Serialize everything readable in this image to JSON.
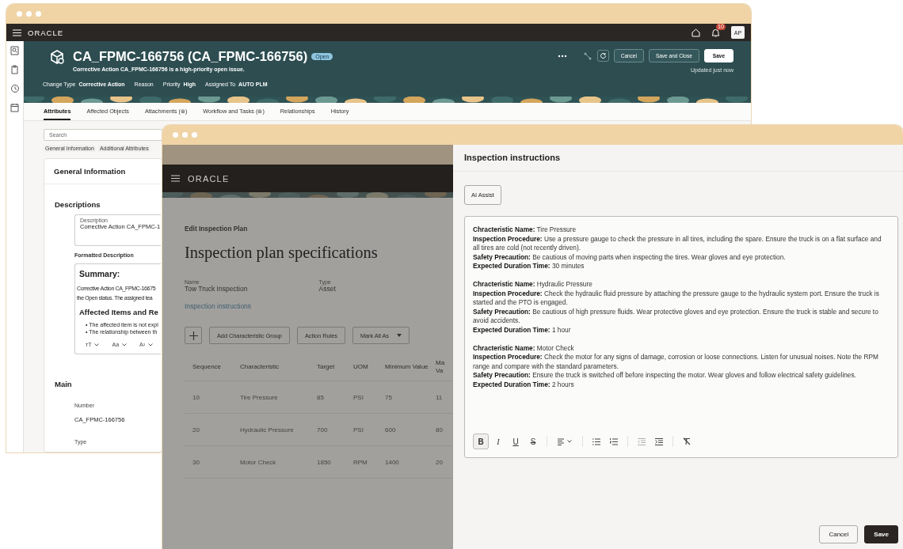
{
  "case_window": {
    "app_bar": {
      "logo": "ORACLE",
      "notification_count": "10",
      "user_initials": "AP"
    },
    "header": {
      "title": "CA_FPMC-166756 (CA_FPMC-166756)",
      "status": "Open",
      "subtitle": "Corrective Action CA_FPMC-166756 is a high-priority open issue.",
      "fields": [
        {
          "label": "Change Type",
          "value": "Corrective Action"
        },
        {
          "label": "Reason"
        },
        {
          "label": "Priority",
          "value": "High"
        },
        {
          "label": "Assigned To",
          "value": "AUTO PLM"
        }
      ],
      "actions": [
        "Cancel",
        "Save and Close"
      ],
      "primary_action": "Save",
      "updated": "Updated just now"
    },
    "tabs": [
      {
        "label": "Attributes",
        "selected": true
      },
      {
        "label": "Affected Objects",
        "selected": false
      },
      {
        "label": "Attachments (⊛)",
        "selected": false
      },
      {
        "label": "Workflow and Tasks (⊛)",
        "selected": false
      },
      {
        "label": "Relationships",
        "selected": false
      },
      {
        "label": "History",
        "selected": false
      }
    ],
    "search": {
      "placeholder": "Search"
    },
    "chips": [
      "General Information",
      "Additional Attributes"
    ],
    "section_title": "General Information",
    "descriptions": {
      "heading": "Descriptions",
      "field_label": "Description",
      "field_value": "Corrective Action CA_FPMC-1",
      "formatted_label": "Formatted Description",
      "summary_heading": "Summary:",
      "summary_lines": [
        "Corrective Action CA_FPMC-16675",
        "the Open status. The assigned tea"
      ],
      "items_heading": "Affected Items and Re",
      "bullets": [
        "• The affected item is not expl",
        "• The relationship between th"
      ],
      "format_tools": [
        "ᴛT",
        "Aa",
        "A²"
      ]
    },
    "main": {
      "heading": "Main",
      "fields": [
        {
          "label": "Number",
          "value": "CA_FPMC-166756"
        },
        {
          "label": "Type"
        }
      ]
    }
  },
  "plan_window": {
    "app_bar": {
      "logo": "ORACLE"
    },
    "breadcrumb": "Edit Inspection Plan",
    "title": "Inspection plan specifications",
    "fields": [
      {
        "label": "Name",
        "value": "Tow Truck Inspection"
      },
      {
        "label": "Type",
        "value": "Asset"
      }
    ],
    "link": "Inspection instructions",
    "buttons": [
      "Add Characteristic Group",
      "Action Rules"
    ],
    "menu_button": "Mark All As",
    "table": {
      "columns": [
        "Sequence",
        "Characteristic",
        "Target",
        "UOM",
        "Minimum Value",
        "Ma Va"
      ],
      "rows": [
        [
          "10",
          "Tire Pressure",
          "85",
          "PSI",
          "75",
          "11"
        ],
        [
          "20",
          "Hydraulic Pressure",
          "700",
          "PSI",
          "600",
          "80"
        ],
        [
          "30",
          "Motor Check",
          "1850",
          "RPM",
          "1400",
          "20"
        ]
      ]
    },
    "instructions_panel": {
      "title": "Inspection instructions",
      "ai_button": "AI Assist",
      "instructions": [
        [
          "**Chracteristic Name:** Tire Pressure",
          "**Inspection Procedure:** Use a pressure gauge to check the pressure in all tires, including the spare. Ensure the truck is on a flat surface and all tires are cold (not recently driven).",
          "**Safety Precaution:** Be cautious of moving parts when inspecting the tires. Wear gloves and eye protection.",
          "**Expected Duration Time:** 30 minutes"
        ],
        [
          "**Chracteristic Name:** Hydraulic Pressure",
          "**Inspection Procedure:** Check the hydraulic fluid pressure by attaching the pressure gauge to the hydraulic system port. Ensure the truck is started and the PTO is engaged.",
          "**Safety Precaution:** Be cautious of high pressure fluids. Wear protective gloves and eye protection. Ensure the truck is stable and secure to avoid accidents.",
          "**Expected Duration Time:** 1 hour"
        ],
        [
          "**Chracteristic Name:** Motor Check",
          "**Inspection Procedure:** Check the motor for any signs of damage, corrosion or loose connections. Listen for unusual noises. Note the RPM range and compare with the standard parameters.",
          "**Safety Precaution:** Ensure the truck is switched off before inspecting the motor. Wear gloves and follow electrical safety guidelines.",
          "**Expected Duration Time:** 2 hours"
        ]
      ],
      "editor_toolbar": [
        {
          "kind": "bold",
          "glyph": "B",
          "selected": true,
          "disabled": false
        },
        {
          "kind": "italic",
          "glyph": "I",
          "selected": false,
          "disabled": false
        },
        {
          "kind": "underline",
          "glyph": "U",
          "selected": false,
          "disabled": false
        },
        {
          "kind": "strikethrough",
          "glyph": "S",
          "selected": false,
          "disabled": false
        },
        {
          "kind": "align",
          "selected": false,
          "disabled": false
        },
        {
          "kind": "bullet-list",
          "selected": false,
          "disabled": false
        },
        {
          "kind": "numbered-list",
          "selected": false,
          "disabled": false
        },
        {
          "kind": "outdent",
          "selected": false,
          "disabled": true
        },
        {
          "kind": "indent",
          "selected": false,
          "disabled": false
        },
        {
          "kind": "clear-format",
          "selected": false,
          "disabled": false
        }
      ],
      "cancel_button": "Cancel",
      "save_button": "Save"
    }
  }
}
